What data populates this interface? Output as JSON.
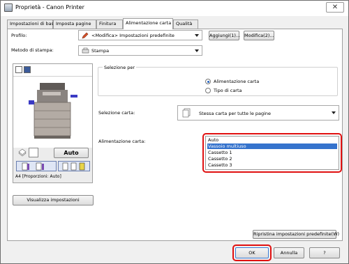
{
  "window": {
    "title": "Proprietà - Canon Printer",
    "close_glyph": "✕"
  },
  "tabs": [
    {
      "label": "Impostazioni di base"
    },
    {
      "label": "Imposta pagine"
    },
    {
      "label": "Finitura"
    },
    {
      "label": "Alimentazione carta"
    },
    {
      "label": "Qualità"
    }
  ],
  "profile": {
    "label": "Profilo:",
    "value": "<Modifica> Impostazioni predefinite",
    "add_label": "Aggiungi(1)...",
    "edit_label": "Modifica(2)..."
  },
  "print_method": {
    "label": "Metodo di stampa:",
    "value": "Stampa"
  },
  "preview": {
    "auto_label": "Auto",
    "paper_info": "A4 [Proporzioni: Auto]",
    "view_settings_label": "Visualizza impostazioni"
  },
  "select_by": {
    "legend": "Selezione per",
    "options": [
      {
        "label": "Alimentazione carta",
        "checked": true
      },
      {
        "label": "Tipo di carta",
        "checked": false
      }
    ]
  },
  "paper_selection": {
    "label": "Selezione carta:",
    "value": "Stessa carta per tutte le pagine"
  },
  "paper_source": {
    "label": "Alimentazione carta:",
    "items": [
      "Auto",
      "Vassoio multiuso",
      "Cassetto 1",
      "Cassetto 2",
      "Cassetto 3"
    ],
    "selected_index": 1
  },
  "restore_defaults_label": "Ripristina impostazioni predefinite(W)",
  "footer": {
    "ok_label": "OK",
    "cancel_label": "Annulla",
    "help_label": "?"
  },
  "colors": {
    "highlight": "#e01010",
    "selection": "#3573cd"
  }
}
